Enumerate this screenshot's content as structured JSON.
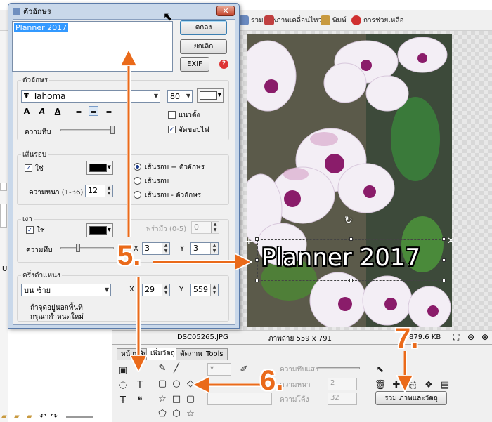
{
  "app_toolbar": {
    "items": [
      {
        "label": "รวมภาพ",
        "icon": "merge-images-icon",
        "color": "#6a8ac0"
      },
      {
        "label": "ภาพเคลื่อนไหว",
        "icon": "animation-icon",
        "color": "#c04040"
      },
      {
        "label": "พิมพ์",
        "icon": "print-icon",
        "color": "#c89a40"
      },
      {
        "label": "การช่วยเหลือ",
        "icon": "help-icon",
        "color": "#d03030"
      }
    ]
  },
  "left_fragments": {
    "un_text": "Un"
  },
  "dialog": {
    "title": "ตัวอักษร",
    "text_value": "Planner 2017",
    "ok_label": "ตกลง",
    "cancel_label": "ยกเลิก",
    "exif_label": "EXIF",
    "font_section": {
      "label": "ตัวอักษร",
      "font_name": "Tahoma",
      "font_size": "80",
      "font_color": "#ffffff",
      "vertical_label": "แนวตั้ง",
      "vertical_checked": false,
      "antialias_label": "จัดขอบไฟ",
      "antialias_checked": true,
      "opacity_label": "ความทึบ",
      "opacity_value": 1.0
    },
    "outline_section": {
      "label": "เส้นรอบ",
      "enable_label": "ใช่",
      "enabled": true,
      "color": "#000000",
      "thickness_label": "ความหนา (1-36)",
      "thickness_value": "12",
      "options": [
        "เส้นรอบ + ตัวอักษร",
        "เส้นรอบ",
        "เส้นรอบ - ตัวอักษร"
      ],
      "selected_option": 0
    },
    "shadow_section": {
      "label": "เงา",
      "enable_label": "ใช่",
      "enabled": true,
      "color": "#000000",
      "blur_label": "พร่ามัว (0-5)",
      "blur_value": "0",
      "opacity_label": "ความทึบ",
      "opacity_value": 0.3,
      "x_label": "X",
      "x_value": "3",
      "y_label": "Y",
      "y_value": "3"
    },
    "position_section": {
      "label": "ครึ่งตำแหน่ง",
      "position_value": "บน ซ้าย",
      "x_label": "X",
      "x_value": "29",
      "y_label": "Y",
      "y_value": "559",
      "note_line1": "ถ้าจุดอยู่นอกพื้นที่",
      "note_line2": "กรุณากำหนดใหม่"
    }
  },
  "status_bar": {
    "filename": "DSC05265.JPG",
    "image_info": "ภาพถ่าย 559 x 791",
    "file_size": "879.6 KB"
  },
  "tools_panel": {
    "tabs": [
      "หน้าหลัก",
      "เพิ่มวัตถุ",
      "ตัดภาพ",
      "Tools"
    ],
    "active_tab": 1,
    "opacity_label": "ความทึบแสง",
    "thickness_label": "ความหนา",
    "thickness_value": "2",
    "roundness_label": "ความโค้ง",
    "roundness_value": "32",
    "combine_label": "รวม ภาพและวัตถุ"
  },
  "overlay_text": "Planner 2017",
  "annotations": {
    "step5": "5.",
    "step6": "6.",
    "step7": "7.",
    "arrow_color": "#ea6a1a"
  }
}
